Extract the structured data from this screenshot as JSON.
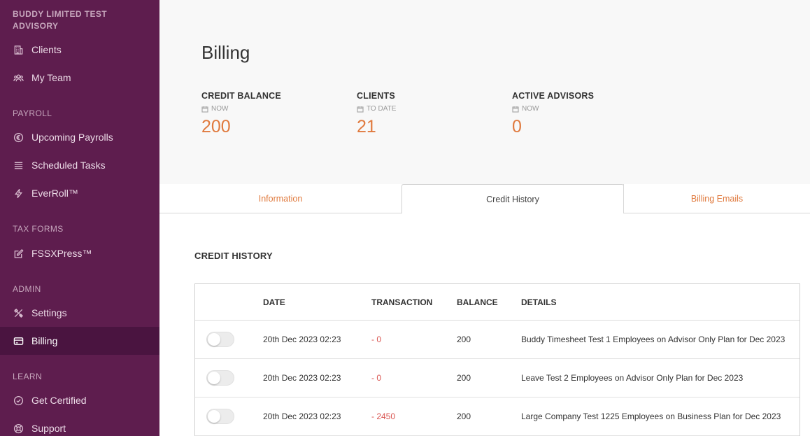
{
  "sidebar": {
    "org_name": "BUDDY LIMITED TEST ADVISORY",
    "nav_clients": "Clients",
    "nav_my_team": "My Team",
    "section_payroll": "PAYROLL",
    "nav_upcoming_payrolls": "Upcoming Payrolls",
    "nav_scheduled_tasks": "Scheduled Tasks",
    "nav_everroll": "EverRoll™",
    "section_tax_forms": "TAX FORMS",
    "nav_fssxpress": "FSSXPress™",
    "section_admin": "ADMIN",
    "nav_settings": "Settings",
    "nav_billing": "Billing",
    "section_learn": "LEARN",
    "nav_get_certified": "Get Certified",
    "nav_support": "Support"
  },
  "main": {
    "title": "Billing",
    "stats": [
      {
        "label": "CREDIT BALANCE",
        "sub": "NOW",
        "value": "200"
      },
      {
        "label": "CLIENTS",
        "sub": "TO DATE",
        "value": "21"
      },
      {
        "label": "ACTIVE ADVISORS",
        "sub": "NOW",
        "value": "0"
      }
    ],
    "tabs": [
      {
        "label": "Information"
      },
      {
        "label": "Credit History"
      },
      {
        "label": "Billing Emails"
      }
    ],
    "section_title": "CREDIT HISTORY",
    "table": {
      "headers": {
        "date": "DATE",
        "transaction": "TRANSACTION",
        "balance": "BALANCE",
        "details": "DETAILS"
      },
      "rows": [
        {
          "date": "20th Dec 2023 02:23",
          "transaction": "- 0",
          "balance": "200",
          "details": "Buddy Timesheet Test 1 Employees on Advisor Only Plan for Dec 2023"
        },
        {
          "date": "20th Dec 2023 02:23",
          "transaction": "- 0",
          "balance": "200",
          "details": "Leave Test 2 Employees on Advisor Only Plan for Dec 2023"
        },
        {
          "date": "20th Dec 2023 02:23",
          "transaction": "- 2450",
          "balance": "200",
          "details": "Large Company Test 1225 Employees on Business Plan for Dec 2023"
        }
      ]
    }
  },
  "colors": {
    "sidebar_bg": "#5e1d4e",
    "sidebar_active": "#4a1440",
    "accent": "#e07a3e",
    "negative": "#d9534f"
  },
  "icons": {
    "clients": "building-icon",
    "my_team": "team-icon",
    "upcoming_payrolls": "euro-icon",
    "scheduled_tasks": "list-icon",
    "everroll": "lightning-icon",
    "fssxpress": "edit-icon",
    "settings": "tools-icon",
    "billing": "credit-card-icon",
    "get_certified": "check-circle-icon",
    "support": "lifebuoy-icon",
    "stat_sub": "calendar-icon"
  }
}
